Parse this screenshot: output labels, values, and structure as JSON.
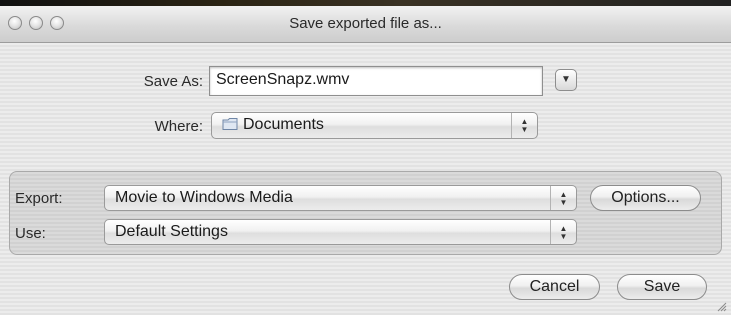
{
  "window": {
    "title": "Save exported file as..."
  },
  "save_as": {
    "label": "Save As:",
    "value": "ScreenSnapz.wmv"
  },
  "where": {
    "label": "Where:",
    "selected": "Documents",
    "icon": "folder-icon"
  },
  "export": {
    "label": "Export:",
    "selected": "Movie to Windows Media",
    "options_button": "Options..."
  },
  "use": {
    "label": "Use:",
    "selected": "Default Settings"
  },
  "buttons": {
    "cancel": "Cancel",
    "save": "Save"
  }
}
